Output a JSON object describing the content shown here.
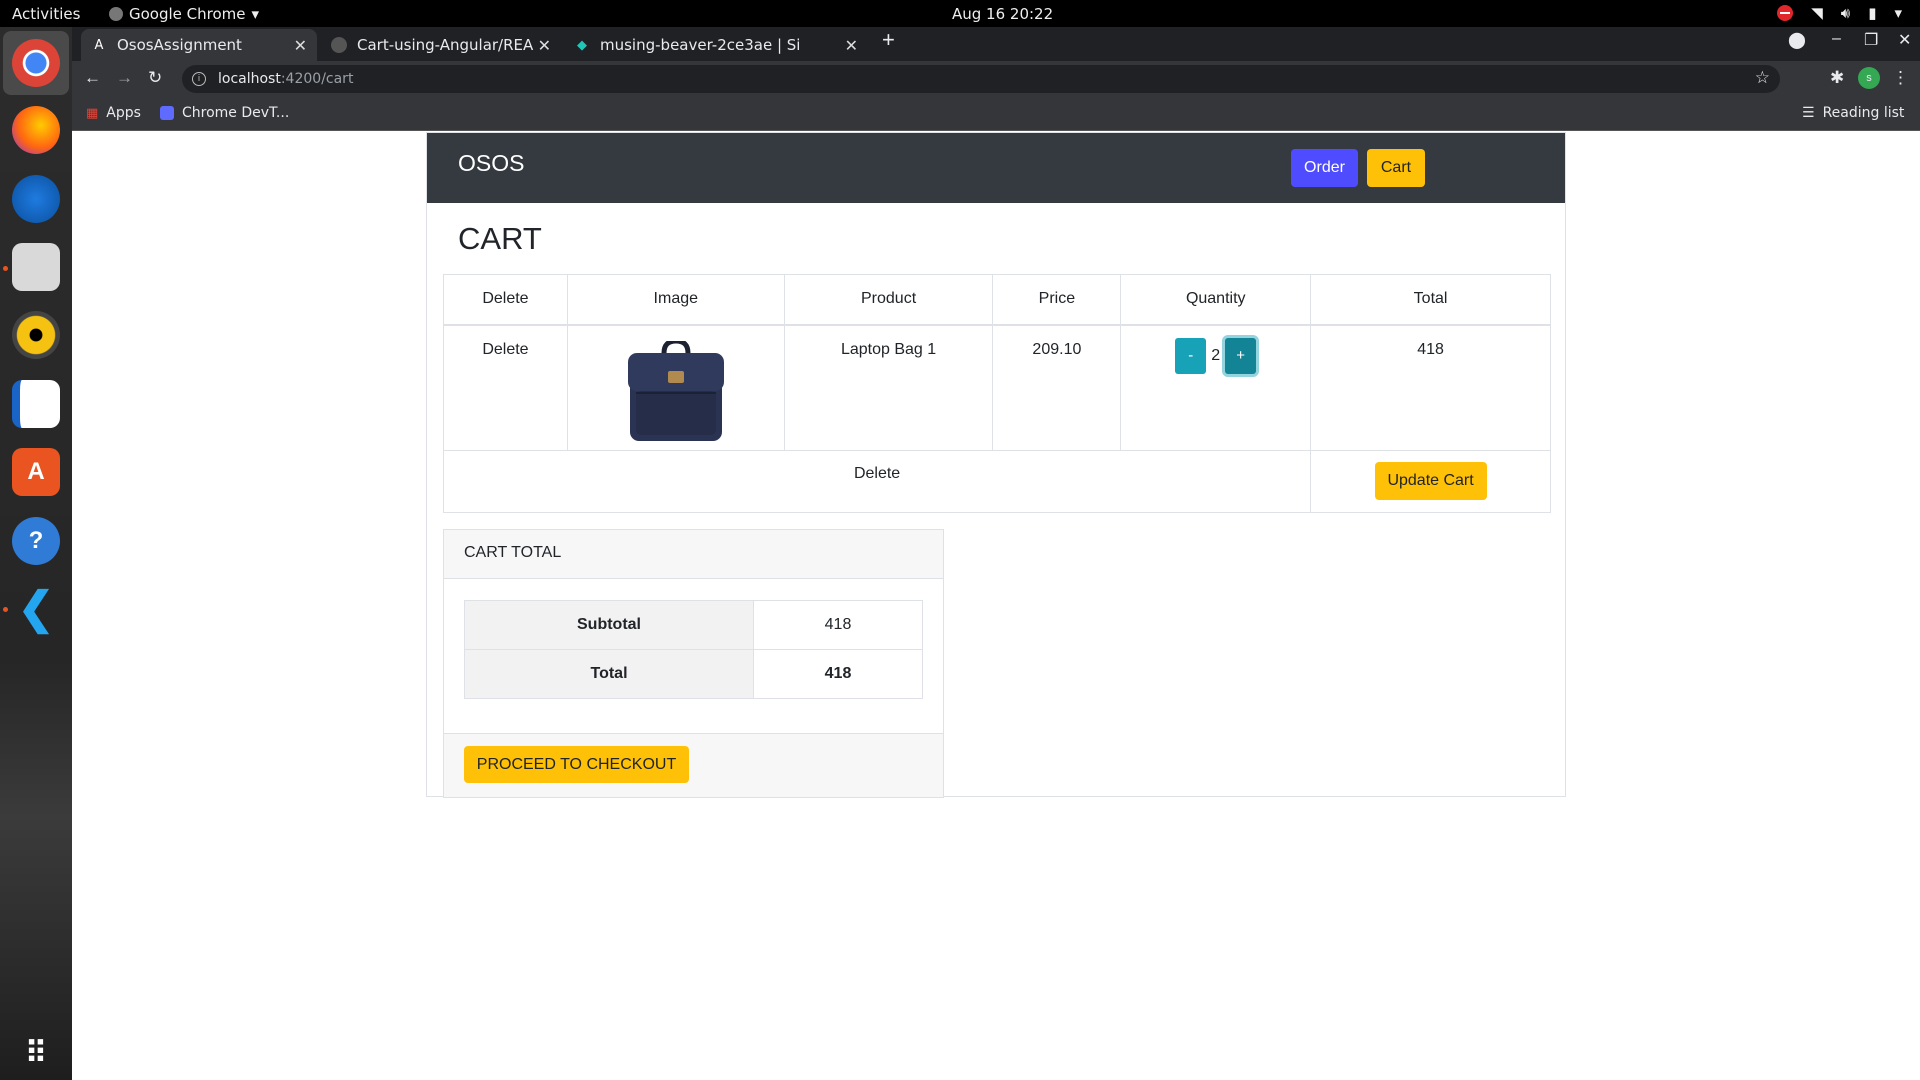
{
  "os": {
    "activities": "Activities",
    "app_name": "Google Chrome",
    "clock": "Aug 16  20:22"
  },
  "browser": {
    "tabs": [
      {
        "title": "OsosAssignment",
        "icon": "angular-icon"
      },
      {
        "title": "Cart-using-Angular/READ",
        "icon": "github-icon"
      },
      {
        "title": "musing-beaver-2ce3ae | Si",
        "icon": "netlify-icon"
      }
    ],
    "url_host": "localhost",
    "url_path": ":4200/cart",
    "bookmarks": [
      "Apps",
      "Chrome DevT..."
    ],
    "reading_list": "Reading list",
    "profile_initial": "s"
  },
  "navbar": {
    "brand": "OSOS",
    "order_label": "Order",
    "cart_label": "Cart"
  },
  "cart": {
    "title": "CART",
    "headers": [
      "Delete",
      "Image",
      "Product",
      "Price",
      "Quantity",
      "Total"
    ],
    "items": [
      {
        "delete_label": "Delete",
        "product": "Laptop Bag 1",
        "price": "209.10",
        "quantity": "2",
        "total": "418",
        "minus": "-",
        "plus": "+"
      }
    ],
    "footer_delete": "Delete",
    "update_label": "Update Cart"
  },
  "totals": {
    "heading": "CART TOTAL",
    "subtotal_label": "Subtotal",
    "subtotal_value": "418",
    "total_label": "Total",
    "total_value": "418",
    "checkout_label": "PROCEED TO CHECKOUT"
  },
  "colors": {
    "navbar": "#343a40",
    "order_button": "#4f4bff",
    "warning": "#ffc107",
    "info": "#17a2b8"
  }
}
